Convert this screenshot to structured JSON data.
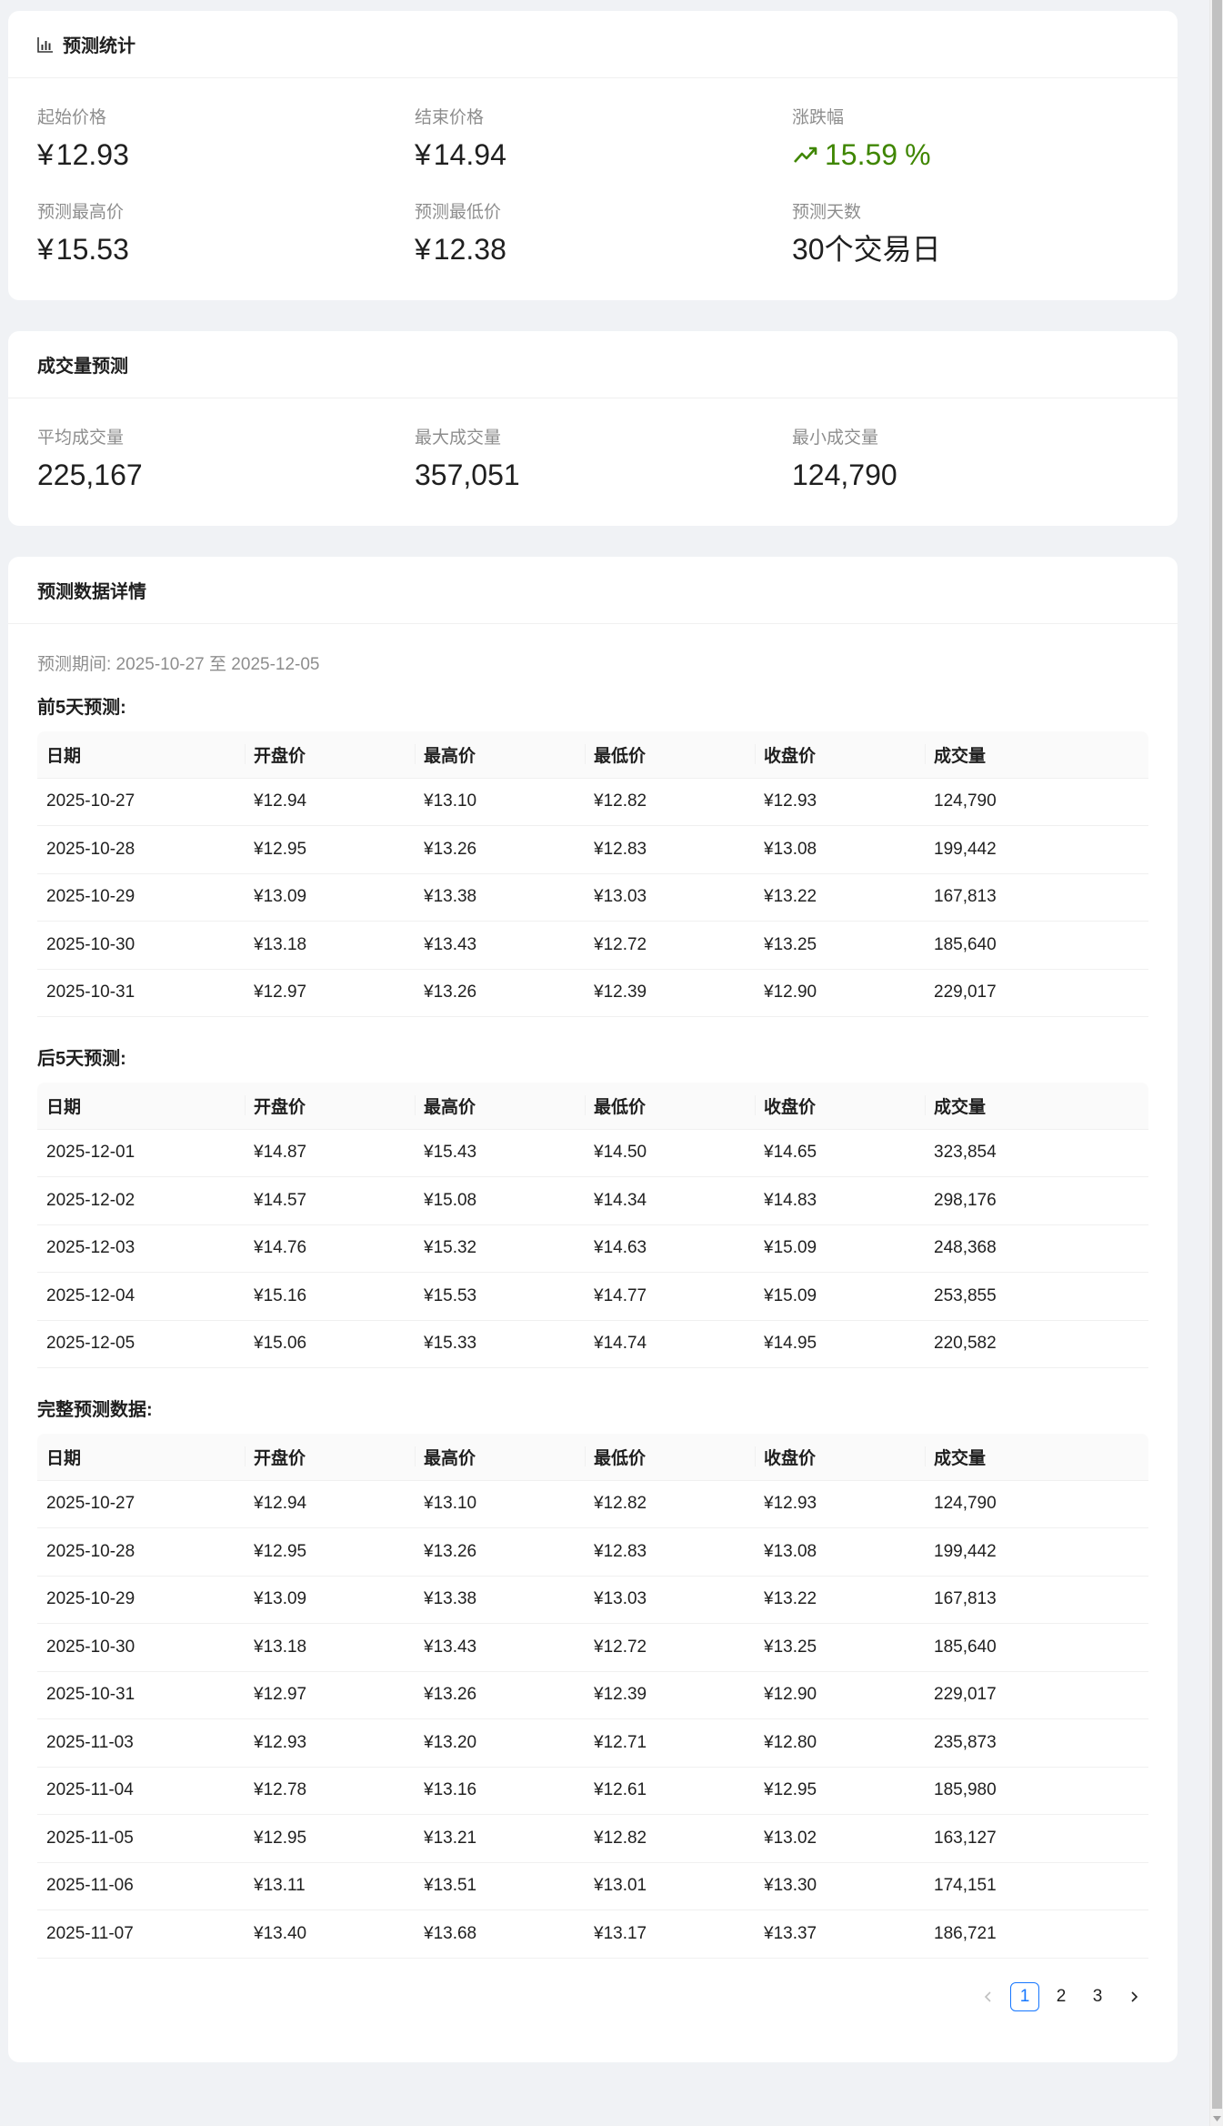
{
  "stats_card": {
    "title": "预测统计",
    "items": [
      {
        "title": "起始价格",
        "prefix": "¥",
        "value": "12.93"
      },
      {
        "title": "结束价格",
        "prefix": "¥",
        "value": "14.94"
      },
      {
        "title": "涨跌幅",
        "value": "15.59",
        "suffix": "%",
        "trend": "up",
        "color": "#3f8600"
      },
      {
        "title": "预测最高价",
        "prefix": "¥",
        "value": "15.53"
      },
      {
        "title": "预测最低价",
        "prefix": "¥",
        "value": "12.38"
      },
      {
        "title": "预测天数",
        "value": "30",
        "suffix": "个交易日"
      }
    ]
  },
  "volume_card": {
    "title": "成交量预测",
    "items": [
      {
        "title": "平均成交量",
        "value": "225,167"
      },
      {
        "title": "最大成交量",
        "value": "357,051"
      },
      {
        "title": "最小成交量",
        "value": "124,790"
      }
    ]
  },
  "detail_card": {
    "title": "预测数据详情",
    "period": "预测期间: 2025-10-27 至 2025-12-05",
    "columns": [
      "日期",
      "开盘价",
      "最高价",
      "最低价",
      "收盘价",
      "成交量"
    ],
    "first5": {
      "title": "前5天预测:",
      "rows": [
        [
          "2025-10-27",
          "¥12.94",
          "¥13.10",
          "¥12.82",
          "¥12.93",
          "124,790"
        ],
        [
          "2025-10-28",
          "¥12.95",
          "¥13.26",
          "¥12.83",
          "¥13.08",
          "199,442"
        ],
        [
          "2025-10-29",
          "¥13.09",
          "¥13.38",
          "¥13.03",
          "¥13.22",
          "167,813"
        ],
        [
          "2025-10-30",
          "¥13.18",
          "¥13.43",
          "¥12.72",
          "¥13.25",
          "185,640"
        ],
        [
          "2025-10-31",
          "¥12.97",
          "¥13.26",
          "¥12.39",
          "¥12.90",
          "229,017"
        ]
      ]
    },
    "last5": {
      "title": "后5天预测:",
      "rows": [
        [
          "2025-12-01",
          "¥14.87",
          "¥15.43",
          "¥14.50",
          "¥14.65",
          "323,854"
        ],
        [
          "2025-12-02",
          "¥14.57",
          "¥15.08",
          "¥14.34",
          "¥14.83",
          "298,176"
        ],
        [
          "2025-12-03",
          "¥14.76",
          "¥15.32",
          "¥14.63",
          "¥15.09",
          "248,368"
        ],
        [
          "2025-12-04",
          "¥15.16",
          "¥15.53",
          "¥14.77",
          "¥15.09",
          "253,855"
        ],
        [
          "2025-12-05",
          "¥15.06",
          "¥15.33",
          "¥14.74",
          "¥14.95",
          "220,582"
        ]
      ]
    },
    "full": {
      "title": "完整预测数据:",
      "rows": [
        [
          "2025-10-27",
          "¥12.94",
          "¥13.10",
          "¥12.82",
          "¥12.93",
          "124,790"
        ],
        [
          "2025-10-28",
          "¥12.95",
          "¥13.26",
          "¥12.83",
          "¥13.08",
          "199,442"
        ],
        [
          "2025-10-29",
          "¥13.09",
          "¥13.38",
          "¥13.03",
          "¥13.22",
          "167,813"
        ],
        [
          "2025-10-30",
          "¥13.18",
          "¥13.43",
          "¥12.72",
          "¥13.25",
          "185,640"
        ],
        [
          "2025-10-31",
          "¥12.97",
          "¥13.26",
          "¥12.39",
          "¥12.90",
          "229,017"
        ],
        [
          "2025-11-03",
          "¥12.93",
          "¥13.20",
          "¥12.71",
          "¥12.80",
          "235,873"
        ],
        [
          "2025-11-04",
          "¥12.78",
          "¥13.16",
          "¥12.61",
          "¥12.95",
          "185,980"
        ],
        [
          "2025-11-05",
          "¥12.95",
          "¥13.21",
          "¥12.82",
          "¥13.02",
          "163,127"
        ],
        [
          "2025-11-06",
          "¥13.11",
          "¥13.51",
          "¥13.01",
          "¥13.30",
          "174,151"
        ],
        [
          "2025-11-07",
          "¥13.40",
          "¥13.68",
          "¥13.17",
          "¥13.37",
          "186,721"
        ]
      ]
    },
    "pagination": {
      "pages": [
        "1",
        "2",
        "3"
      ],
      "current": 1,
      "active_color": "#1677ff"
    }
  },
  "icons": {
    "stats_title": "bar-chart-icon",
    "trend": "rise-arrow-icon",
    "prev": "chevron-left-icon",
    "next": "chevron-right-icon"
  }
}
